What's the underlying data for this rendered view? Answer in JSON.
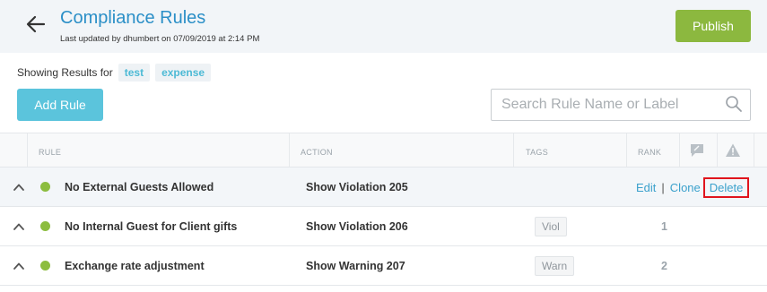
{
  "header": {
    "title": "Compliance Rules",
    "subtitle": "Last updated by dhumbert on 07/09/2019 at 2:14 PM",
    "publish_label": "Publish",
    "back_icon": "arrow-left-icon"
  },
  "filters": {
    "showing_label": "Showing Results for",
    "chips": [
      "test",
      "expense"
    ]
  },
  "toolbar": {
    "add_rule_label": "Add Rule"
  },
  "search": {
    "placeholder": "Search Rule Name or Label",
    "value": ""
  },
  "table": {
    "columns": {
      "rule": "RULE",
      "action": "ACTION",
      "tags": "TAGS",
      "rank": "RANK"
    },
    "rows": [
      {
        "name": "No External Guests Allowed",
        "action": "Show Violation 205",
        "tag": "",
        "rank": "",
        "hover": true,
        "edit_label": "Edit",
        "clone_label": "Clone",
        "delete_label": "Delete"
      },
      {
        "name": "No Internal Guest for Client gifts",
        "action": "Show Violation 206",
        "tag": "Viol",
        "rank": "1"
      },
      {
        "name": "Exchange rate adjustment",
        "action": "Show Warning 207",
        "tag": "Warn",
        "rank": "2"
      }
    ]
  },
  "colors": {
    "title": "#2b8fc7",
    "publish": "#8cb83f",
    "add_rule": "#5bc4dc",
    "status_dot": "#8cbd3f",
    "delete_highlight": "#e0141d"
  }
}
